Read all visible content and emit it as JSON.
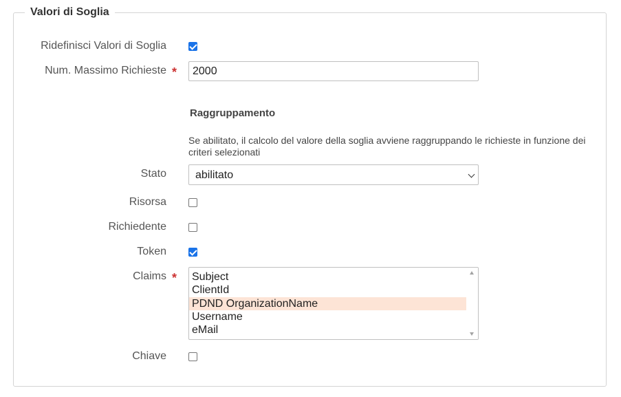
{
  "section": {
    "legend": "Valori di Soglia"
  },
  "fields": {
    "ridefinisci": {
      "label": "Ridefinisci Valori di Soglia",
      "checked": true
    },
    "num_massimo": {
      "label": "Num. Massimo Richieste",
      "required_mark": "*",
      "value": "2000"
    },
    "raggruppamento": {
      "title": "Raggruppamento",
      "help": "Se abilitato, il calcolo del valore della soglia avviene raggruppando le richieste in funzione dei criteri selezionati"
    },
    "stato": {
      "label": "Stato",
      "value": "abilitato"
    },
    "risorsa": {
      "label": "Risorsa",
      "checked": false
    },
    "richiedente": {
      "label": "Richiedente",
      "checked": false
    },
    "token": {
      "label": "Token",
      "checked": true
    },
    "claims": {
      "label": "Claims",
      "required_mark": "*",
      "options": [
        "Subject",
        "ClientId",
        "PDND OrganizationName",
        "Username",
        "eMail"
      ],
      "selected": "PDND OrganizationName"
    },
    "chiave": {
      "label": "Chiave",
      "checked": false
    }
  },
  "colors": {
    "checkbox_checked": "#1a73e8",
    "required": "#cc3333",
    "selected_option": "#fde4d6"
  },
  "icons": {
    "select_arrow": "chevron-down-icon",
    "scroll_up": "scroll-up-icon",
    "scroll_down": "scroll-down-icon"
  }
}
